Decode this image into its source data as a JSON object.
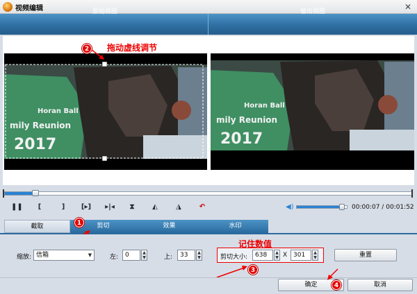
{
  "window": {
    "title": "视频编辑",
    "close_glyph": "✕"
  },
  "views": {
    "original_label": "原始视图",
    "output_label": "输出视图"
  },
  "annotations": {
    "drag_hint": "拖动虚线调节",
    "remember_hint": "记住数值",
    "badge_1": "1",
    "badge_2": "2",
    "badge_3": "3",
    "badge_4": "4",
    "accent_color": "#e00000"
  },
  "playback": {
    "progress_fraction": 0.075,
    "volume_fraction": 0.92,
    "current_time": "00:00:07",
    "separator": "/",
    "total_time": "00:01:52",
    "controls": [
      {
        "name": "pause-icon",
        "glyph": "❚❚"
      },
      {
        "name": "mark-in-icon",
        "glyph": "["
      },
      {
        "name": "mark-out-icon",
        "glyph": "]"
      },
      {
        "name": "play-selection-icon",
        "glyph": "[▸]"
      },
      {
        "name": "step-icon",
        "glyph": "▸|◂"
      },
      {
        "name": "flip-vertical-icon",
        "glyph": "⧗"
      },
      {
        "name": "rotate-left-icon",
        "glyph": "◭"
      },
      {
        "name": "rotate-right-icon",
        "glyph": "◮"
      },
      {
        "name": "undo-icon",
        "glyph": "↶"
      }
    ]
  },
  "tabs": [
    {
      "name": "tab-extract",
      "label": "截取"
    },
    {
      "name": "tab-crop",
      "label": "剪切"
    },
    {
      "name": "tab-effect",
      "label": "效果"
    },
    {
      "name": "tab-watermark",
      "label": "水印"
    }
  ],
  "crop": {
    "zoom_label": "缩放:",
    "zoom_value": "信箱",
    "left_label": "左:",
    "left_value": "0",
    "top_label": "上:",
    "top_value": "33",
    "size_label": "剪切大小:",
    "width_value": "638",
    "x_separator": "X",
    "height_value": "301",
    "reset_label": "重置"
  },
  "footer": {
    "ok_label": "确定",
    "cancel_label": "取消"
  }
}
